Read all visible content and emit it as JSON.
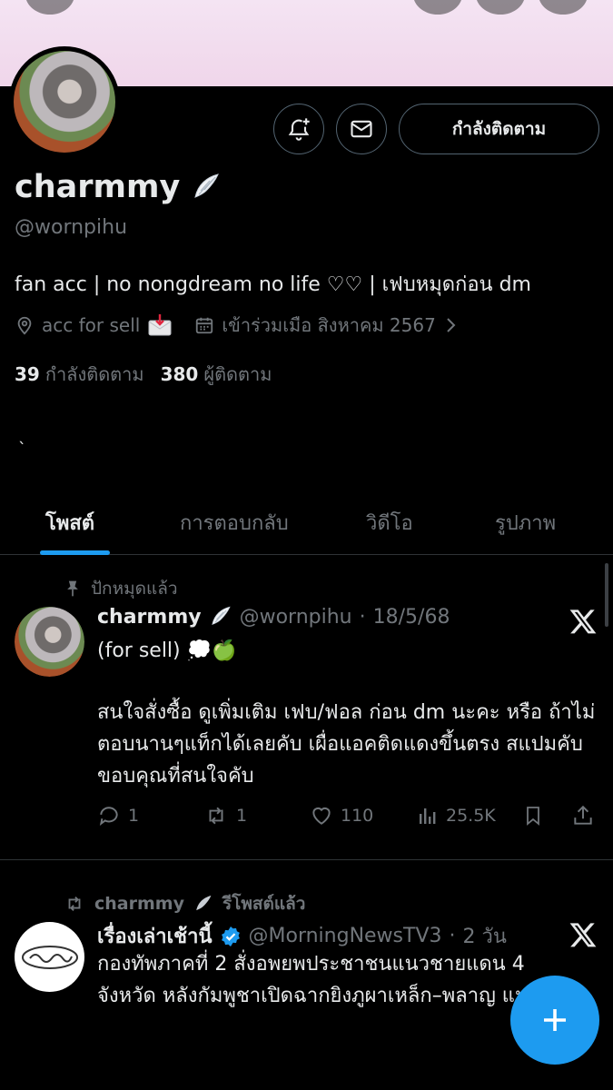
{
  "profile": {
    "name": "charmmy",
    "handle": "@wornpihu",
    "bio": "fan acc | no nongdream no life ♡♡ | เฟบหมุดก่อน dm",
    "location": "acc for sell",
    "joined": "เข้าร่วมเมือ สิงหาคม 2567",
    "following_count": "39",
    "following_label": "กำลังติดตาม",
    "followers_count": "380",
    "followers_label": "ผู้ติดตาม",
    "follow_button": "กำลังติดตาม",
    "stray_text": "`"
  },
  "tabs": [
    {
      "label": "โพสต์",
      "active": true
    },
    {
      "label": "การตอบกลับ",
      "active": false
    },
    {
      "label": "วิดีโอ",
      "active": false
    },
    {
      "label": "รูปภาพ",
      "active": false
    }
  ],
  "posts": [
    {
      "context": "ปักหมุดแล้ว",
      "author": "charmmy",
      "handle": "@wornpihu",
      "date": "18/5/68",
      "line1": "(for sell) 💭🍏",
      "body": "สนใจสั่งซื้อ ดูเพิ่มเติม เฟบ/ฟอล ก่อน dm นะคะ หรือ ถ้าไม่ตอบนานๆแท็กได้เลยคับ เผื่อแอคติดแดงขึ้นตรง สแปมคับ ขอบคุณที่สนใจคับ",
      "replies": "1",
      "reposts": "1",
      "likes": "110",
      "views": "25.5K"
    },
    {
      "context_name": "charmmy",
      "context_action": "รีโพสต์แล้ว",
      "author": "เรื่องเล่าเช้านี้",
      "handle": "@MorningNewsTV3",
      "date": "2 วัน",
      "body": "กองทัพภาคที่ 2 สั่งอพยพประชาชนแนวชายแดน 4 จังหวัด หลังกัมพูชาเปิดฉากยิงภูผาเหล็ก–พลาญ แปดก้อน"
    }
  ],
  "colors": {
    "accent": "#1d9bf0",
    "secondary_text": "#71767b",
    "border": "#2f3336"
  }
}
